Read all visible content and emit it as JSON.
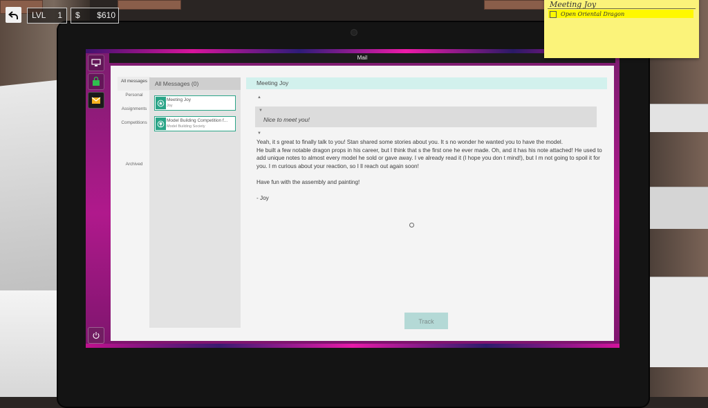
{
  "hud": {
    "level_label": "LVL",
    "level_value": "1",
    "currency_symbol": "$",
    "money": "$610"
  },
  "sticky_note": {
    "title": "Meeting Joy",
    "task": "Open Oriental Dragon"
  },
  "window": {
    "title": "Mail"
  },
  "folders": [
    "All messages",
    "Personal",
    "Assignments",
    "Competitions",
    "Archived"
  ],
  "list": {
    "header": "All Messages (0)",
    "messages": [
      {
        "subject": "Meeting Joy",
        "sender": "Joy",
        "icon": "star-badge-icon"
      },
      {
        "subject": "Model Building Competition f...",
        "sender": "Model Building Society",
        "icon": "trophy-badge-icon"
      }
    ]
  },
  "message": {
    "title": "Meeting Joy",
    "quote": "Nice to meet you!",
    "body": [
      "Yeah, it s great to finally talk to you! Stan shared some stories about you. It s no wonder he wanted you to have the model.",
      "He built a few notable dragon props in his career, but I think that s the first one he ever made. Oh, and it has his note attached! He used to add unique notes to almost every model he sold or gave away. I ve already read it (I hope you don t mind!), but I m not going to spoil it for you. I m curious about your reaction, so I ll reach out again soon!",
      "Have fun with the assembly and painting!",
      "- Joy"
    ],
    "track_button": "Track"
  },
  "colors": {
    "accent": "#2aa487",
    "title_bar_bg": "#d2f1ed",
    "screen_magenta": "#b0198c",
    "sticky_yellow": "#fbf37a"
  }
}
